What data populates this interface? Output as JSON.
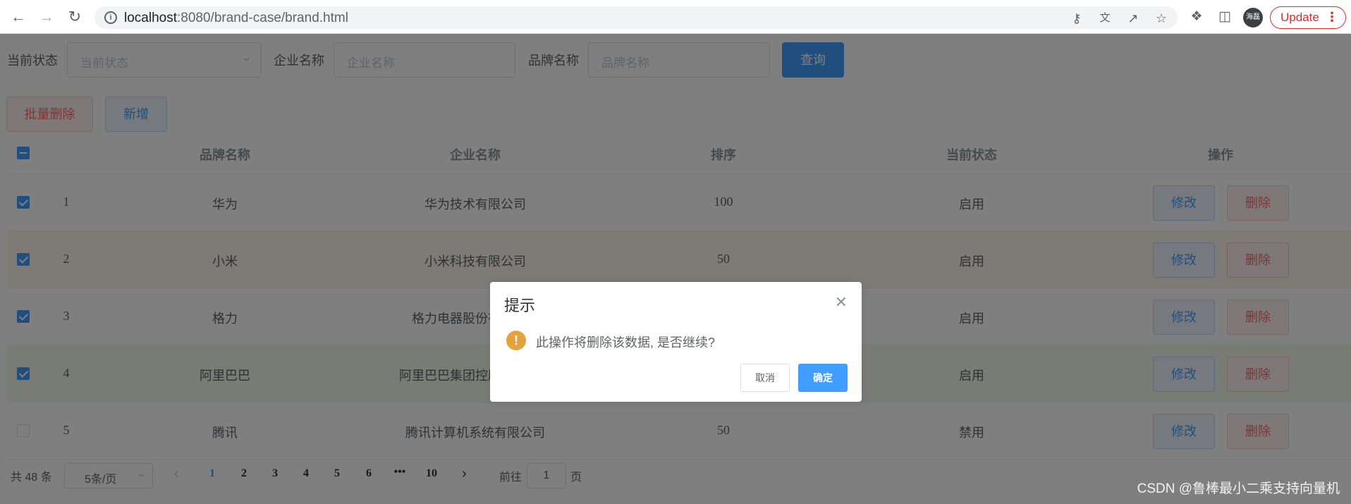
{
  "browser": {
    "url_host": "localhost",
    "url_rest": ":8080/brand-case/brand.html",
    "avatar_text": "海磊",
    "update_label": "Update"
  },
  "search": {
    "status_label": "当前状态",
    "status_placeholder": "当前状态",
    "company_label": "企业名称",
    "company_placeholder": "企业名称",
    "brand_label": "品牌名称",
    "brand_placeholder": "品牌名称",
    "query_button": "查询"
  },
  "actions": {
    "batch_delete": "批量删除",
    "add": "新增"
  },
  "table": {
    "headers": {
      "brand": "品牌名称",
      "company": "企业名称",
      "order": "排序",
      "status": "当前状态",
      "ops": "操作"
    },
    "edit_label": "修改",
    "delete_label": "删除",
    "rows": [
      {
        "index": "1",
        "brand": "华为",
        "company": "华为技术有限公司",
        "order": "100",
        "status": "启用",
        "checked": true,
        "highlight": "none"
      },
      {
        "index": "2",
        "brand": "小米",
        "company": "小米科技有限公司",
        "order": "50",
        "status": "启用",
        "checked": true,
        "highlight": "warning"
      },
      {
        "index": "3",
        "brand": "格力",
        "company": "格力电器股份有限公司",
        "order": "",
        "status": "启用",
        "checked": true,
        "highlight": "none"
      },
      {
        "index": "4",
        "brand": "阿里巴巴",
        "company": "阿里巴巴集团控股有限公司",
        "order": "",
        "status": "启用",
        "checked": true,
        "highlight": "success"
      },
      {
        "index": "5",
        "brand": "腾讯",
        "company": "腾讯计算机系统有限公司",
        "order": "50",
        "status": "禁用",
        "checked": false,
        "highlight": "none"
      }
    ]
  },
  "pagination": {
    "total": "共 48 条",
    "page_size": "5条/页",
    "pages": [
      "1",
      "2",
      "3",
      "4",
      "5",
      "6",
      "•••",
      "10"
    ],
    "active_page": "1",
    "goto_label": "前往",
    "goto_value": "1",
    "page_unit": "页"
  },
  "dialog": {
    "title": "提示",
    "message": "此操作将删除该数据, 是否继续?",
    "cancel": "取消",
    "confirm": "确定"
  },
  "watermark": "CSDN @鲁棒最小二乘支持向量机",
  "colors": {
    "primary": "#409eff",
    "danger": "#f56c6c",
    "warning": "#e6a23c",
    "row_warning": "#fdf6ec",
    "row_success": "#f0f9eb"
  }
}
